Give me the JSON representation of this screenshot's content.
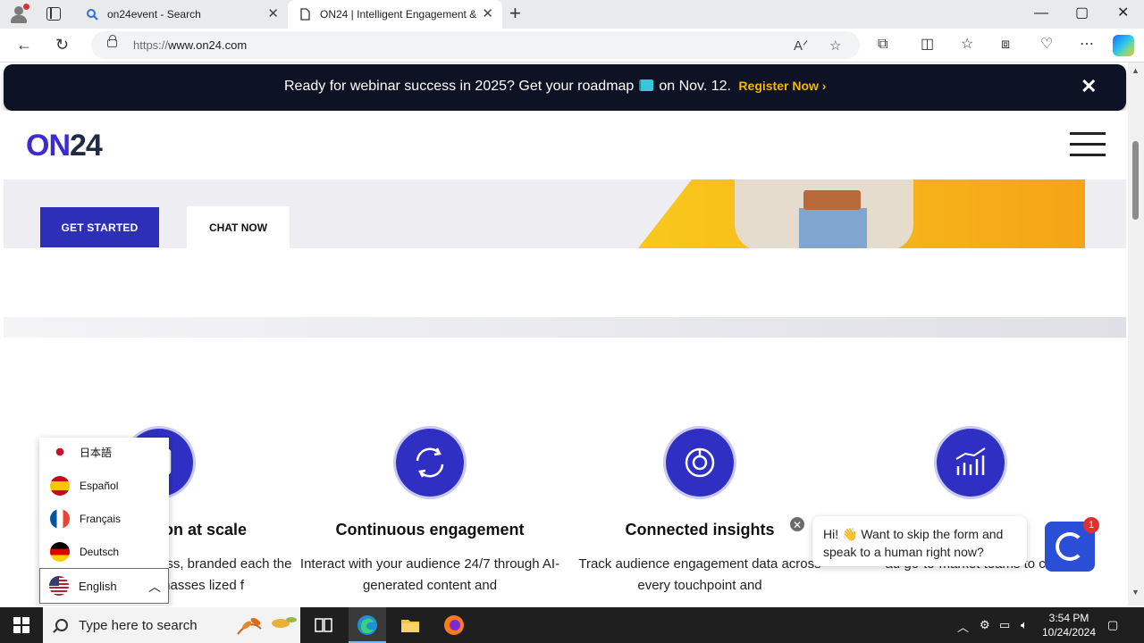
{
  "browser": {
    "tabs": [
      {
        "label": "on24event - Search",
        "active": false
      },
      {
        "label": "ON24 | Intelligent Engagement & ",
        "active": true
      }
    ],
    "url_protocol": "https://",
    "url_host": "www.on24.com",
    "window_controls": {
      "minimize": "—",
      "maximize": "▢",
      "close": "✕"
    }
  },
  "page": {
    "banner": {
      "text": "Ready for webinar success in 2025? Get your roadmap",
      "date_text": "on Nov. 12.",
      "cta": "Register Now ›",
      "close": "✕"
    },
    "header": {
      "logo_on": "ON",
      "logo_num": "24"
    },
    "hero": {
      "get_started": "GET STARTED",
      "chat_now": "CHAT NOW"
    },
    "features": [
      {
        "title": "ion at scale",
        "desc": "ess, branded each the masses lized f",
        "icon": "browser-window-icon"
      },
      {
        "title": "Continuous engagement",
        "desc": "Interact with your audience 24/7 through AI-generated content and",
        "icon": "refresh-cycle-icon"
      },
      {
        "title": "Connected insights",
        "desc": "Track audience engagement data across every touchpoint and",
        "icon": "pie-chart-icon"
      },
      {
        "title": "",
        "desc": "ad go-to-market teams to convert",
        "icon": "line-bar-chart-icon"
      }
    ],
    "language": {
      "options": [
        "日本語",
        "Español",
        "Français",
        "Deutsch"
      ],
      "selected": "English"
    },
    "chat": {
      "message": "Hi! 👋 Want to skip the form and speak to a human right now?",
      "badge": "1",
      "close": "✕"
    }
  },
  "taskbar": {
    "search_placeholder": "Type here to search",
    "time": "3:54 PM",
    "date": "10/24/2024"
  },
  "colors": {
    "brand": "#2d2fb8",
    "banner_bg": "#0d1224",
    "cta": "#f7b500"
  }
}
